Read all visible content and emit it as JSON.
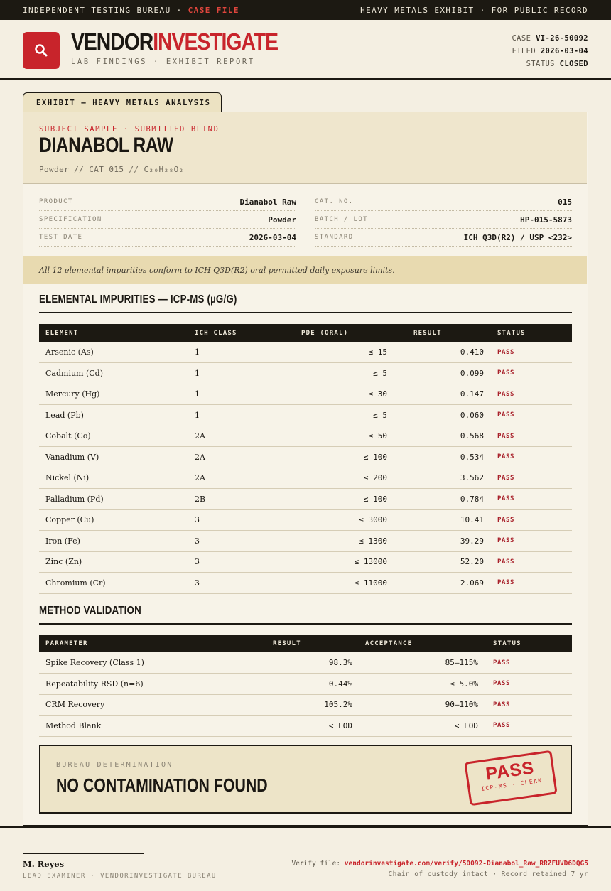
{
  "topbar": {
    "left_text": "INDEPENDENT TESTING BUREAU · ",
    "left_accent": "CASE FILE",
    "right_text": "HEAVY METALS EXHIBIT · FOR PUBLIC RECORD"
  },
  "header": {
    "brand_part1": "VENDOR",
    "brand_part2": "INVESTIGATE",
    "tagline": "LAB FINDINGS · EXHIBIT REPORT",
    "logo_icon": "magnifier-icon",
    "case_label": "CASE",
    "case_value": "VI-26-50092",
    "filed_label": "FILED",
    "filed_value": "2026-03-04",
    "status_label": "STATUS",
    "status_value": "CLOSED"
  },
  "exhibit": {
    "tab_label": "EXHIBIT — HEAVY METALS ANALYSIS",
    "kicker": "SUBJECT SAMPLE · SUBMITTED BLIND",
    "title": "DIANABOL RAW",
    "subtitle": "Powder  //  CAT 015  //  C₂₀H₂₈O₂"
  },
  "specs": [
    {
      "k": "PRODUCT",
      "v": "Dianabol Raw"
    },
    {
      "k": "CAT. NO.",
      "v": "015"
    },
    {
      "k": "SPECIFICATION",
      "v": "Powder"
    },
    {
      "k": "BATCH / LOT",
      "v": "HP-015-5873"
    },
    {
      "k": "TEST DATE",
      "v": "2026-03-04"
    },
    {
      "k": "STANDARD",
      "v": "ICH Q3D(R2) / USP <232>"
    }
  ],
  "conformance": "All 12 elemental impurities conform to ICH Q3D(R2) oral permitted daily exposure limits.",
  "impurities": {
    "title": "ELEMENTAL IMPURITIES — ICP-MS (µG/G)",
    "headers": [
      "ELEMENT",
      "ICH CLASS",
      "PDE (ORAL)",
      "RESULT",
      "STATUS"
    ],
    "rows": [
      {
        "element": "Arsenic (As)",
        "cls": "1",
        "pde": "≤ 15",
        "result": "0.410",
        "status": "PASS"
      },
      {
        "element": "Cadmium (Cd)",
        "cls": "1",
        "pde": "≤ 5",
        "result": "0.099",
        "status": "PASS"
      },
      {
        "element": "Mercury (Hg)",
        "cls": "1",
        "pde": "≤ 30",
        "result": "0.147",
        "status": "PASS"
      },
      {
        "element": "Lead (Pb)",
        "cls": "1",
        "pde": "≤ 5",
        "result": "0.060",
        "status": "PASS"
      },
      {
        "element": "Cobalt (Co)",
        "cls": "2A",
        "pde": "≤ 50",
        "result": "0.568",
        "status": "PASS"
      },
      {
        "element": "Vanadium (V)",
        "cls": "2A",
        "pde": "≤ 100",
        "result": "0.534",
        "status": "PASS"
      },
      {
        "element": "Nickel (Ni)",
        "cls": "2A",
        "pde": "≤ 200",
        "result": "3.562",
        "status": "PASS"
      },
      {
        "element": "Palladium (Pd)",
        "cls": "2B",
        "pde": "≤ 100",
        "result": "0.784",
        "status": "PASS"
      },
      {
        "element": "Copper (Cu)",
        "cls": "3",
        "pde": "≤ 3000",
        "result": "10.41",
        "status": "PASS"
      },
      {
        "element": "Iron (Fe)",
        "cls": "3",
        "pde": "≤ 1300",
        "result": "39.29",
        "status": "PASS"
      },
      {
        "element": "Zinc (Zn)",
        "cls": "3",
        "pde": "≤ 13000",
        "result": "52.20",
        "status": "PASS"
      },
      {
        "element": "Chromium (Cr)",
        "cls": "3",
        "pde": "≤ 11000",
        "result": "2.069",
        "status": "PASS"
      }
    ]
  },
  "validation": {
    "title": "METHOD VALIDATION",
    "headers": [
      "PARAMETER",
      "RESULT",
      "ACCEPTANCE",
      "STATUS"
    ],
    "rows": [
      {
        "param": "Spike Recovery (Class 1)",
        "result": "98.3%",
        "acceptance": "85–115%",
        "status": "PASS"
      },
      {
        "param": "Repeatability RSD (n=6)",
        "result": "0.44%",
        "acceptance": "≤ 5.0%",
        "status": "PASS"
      },
      {
        "param": "CRM Recovery",
        "result": "105.2%",
        "acceptance": "90–110%",
        "status": "PASS"
      },
      {
        "param": "Method Blank",
        "result": "< LOD",
        "acceptance": "< LOD",
        "status": "PASS"
      }
    ]
  },
  "determination": {
    "label": "BUREAU DETERMINATION",
    "value": "NO CONTAMINATION FOUND",
    "stamp_main": "PASS",
    "stamp_sub": "ICP-MS · CLEAN"
  },
  "footer": {
    "signer": "M. Reyes",
    "role": "LEAD EXAMINER · VENDORINVESTIGATE BUREAU",
    "verify_label": "Verify file: ",
    "verify_link": "vendorinvestigate.com/verify/50092-Dianabol_Raw_RRZFUVD6DQG5",
    "custody": "Chain of custody intact · Record retained 7 yr"
  },
  "colors": {
    "accent": "#c8242b",
    "ink": "#1c1912",
    "paper": "#f4efe2",
    "tint": "#e8dab0"
  }
}
